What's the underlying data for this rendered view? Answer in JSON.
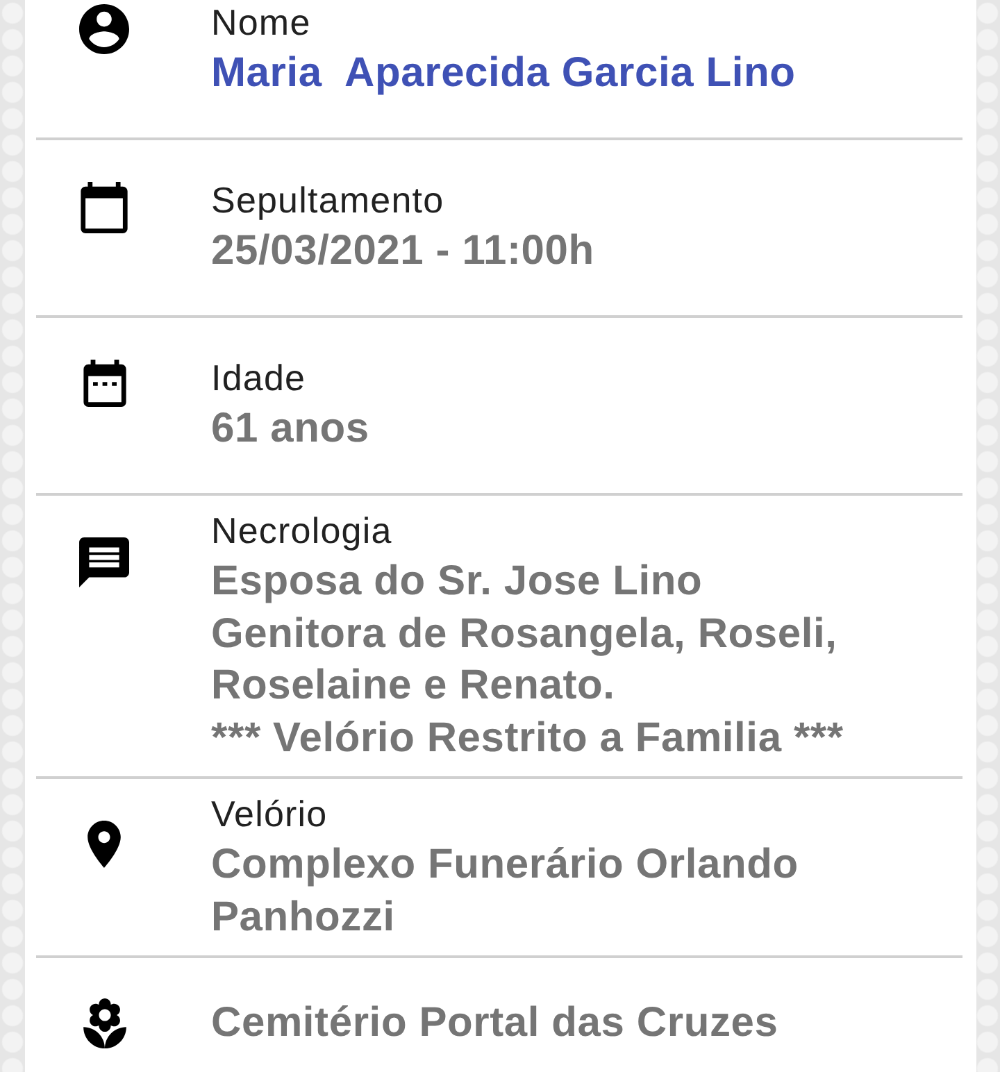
{
  "rows": [
    {
      "kind": "person",
      "label": "Nome",
      "lines": [
        "Maria  Aparecida Garcia Lino"
      ]
    },
    {
      "kind": "calendar",
      "label": "Sepultamento",
      "lines": [
        "25/03/2021 - 11:00h"
      ]
    },
    {
      "kind": "calendar-dots",
      "label": "Idade",
      "lines": [
        "61 anos"
      ]
    },
    {
      "kind": "message",
      "label": "Necrologia",
      "lines": [
        "Esposa do Sr. Jose Lino",
        "Genitora de Rosangela, Roseli,",
        "Roselaine e Renato.",
        "*** Velório Restrito a Familia ***"
      ]
    },
    {
      "kind": "place",
      "label": "Velório",
      "lines": [
        "Complexo Funerário Orlando",
        "Panhozzi"
      ]
    },
    {
      "kind": "flower",
      "lines": [
        "Cemitério Portal das Cruzes"
      ]
    }
  ]
}
